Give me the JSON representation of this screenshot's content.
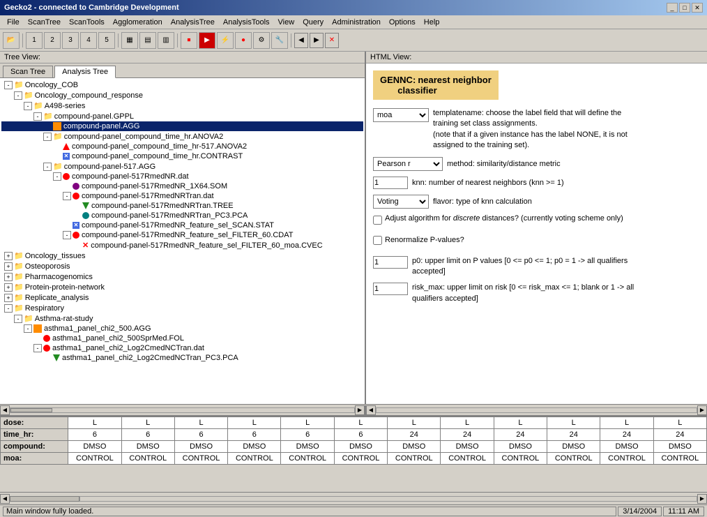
{
  "window": {
    "title": "Gecko2 - connected to Cambridge Development",
    "title_bar_buttons": [
      "_",
      "□",
      "✕"
    ]
  },
  "menu": {
    "items": [
      "File",
      "ScanTree",
      "ScanTools",
      "Agglomeration",
      "AnalysisTree",
      "AnalysisTools",
      "View",
      "Query",
      "Administration",
      "Options",
      "Help"
    ]
  },
  "toolbar": {
    "buttons": [
      "□",
      "1",
      "2",
      "3",
      "4",
      "5",
      "□",
      "□",
      "□",
      "●",
      "🔴",
      "⚡",
      "🔴",
      "⚙",
      "⚙"
    ],
    "nav": [
      "◀",
      "▶",
      "✕"
    ]
  },
  "tree_view": {
    "label": "Tree View:",
    "tabs": [
      "Scan Tree",
      "Analysis Tree"
    ],
    "active_tab": "Analysis Tree"
  },
  "tree_items": [
    {
      "id": "oncology_cob",
      "label": "Oncology_COB",
      "level": 0,
      "type": "folder",
      "expanded": true
    },
    {
      "id": "oncology_compound",
      "label": "Oncology_compound_response",
      "level": 1,
      "type": "folder",
      "expanded": true
    },
    {
      "id": "a498",
      "label": "A498-series",
      "level": 2,
      "type": "folder",
      "expanded": true
    },
    {
      "id": "compound_gppl",
      "label": "compound-panel.GPPL",
      "level": 3,
      "type": "folder",
      "expanded": true
    },
    {
      "id": "compound_agg",
      "label": "compound-panel.AGG",
      "level": 4,
      "type": "orange-sq",
      "selected": true
    },
    {
      "id": "compound_anova2",
      "label": "compound-panel_compound_time_hr.ANOVA2",
      "level": 4,
      "type": "folder"
    },
    {
      "id": "compound_anova2b",
      "label": "compound-panel_compound_time_hr-517.ANOVA2",
      "level": 5,
      "type": "tri-up-red"
    },
    {
      "id": "compound_contrast",
      "label": "compound-panel_compound_time_hr.CONTRAST",
      "level": 5,
      "type": "blue-x"
    },
    {
      "id": "compound_517agg",
      "label": "compound-panel-517.AGG",
      "level": 4,
      "type": "folder",
      "expanded": true
    },
    {
      "id": "compound_517rmed",
      "label": "compound-panel-517RmedNR.dat",
      "level": 5,
      "type": "red-circle"
    },
    {
      "id": "compound_517_1x64",
      "label": "compound-panel-517RmedNR_1X64.SOM",
      "level": 6,
      "type": "purple-circle"
    },
    {
      "id": "compound_517tran",
      "label": "compound-panel-517RmedNRTran.dat",
      "level": 6,
      "type": "red-circle"
    },
    {
      "id": "compound_517tree",
      "label": "compound-panel-517RmedNRTran.TREE",
      "level": 7,
      "type": "tri-down-green"
    },
    {
      "id": "compound_517pca",
      "label": "compound-panel-517RmedNRTran_PC3.PCA",
      "level": 7,
      "type": "teal-circle"
    },
    {
      "id": "compound_feature_scan",
      "label": "compound-panel-517RmedNR_feature_sel_SCAN.STAT",
      "level": 6,
      "type": "blue-x"
    },
    {
      "id": "compound_feature_filter",
      "label": "compound-panel-517RmedNR_feature_sel_FILTER_60.CDAT",
      "level": 6,
      "type": "red-circle"
    },
    {
      "id": "compound_cvec",
      "label": "compound-panel-517RmedNR_feature_sel_FILTER_60_moa.CVEC",
      "level": 7,
      "type": "red-x"
    },
    {
      "id": "oncology_tissues",
      "label": "Oncology_tissues",
      "level": 0,
      "type": "folder"
    },
    {
      "id": "osteoporosis",
      "label": "Osteoporosis",
      "level": 0,
      "type": "folder"
    },
    {
      "id": "pharmacogenomics",
      "label": "Pharmacogenomics",
      "level": 0,
      "type": "folder"
    },
    {
      "id": "protein_network",
      "label": "Protein-protein-network",
      "level": 0,
      "type": "folder"
    },
    {
      "id": "replicate_analysis",
      "label": "Replicate_analysis",
      "level": 0,
      "type": "folder"
    },
    {
      "id": "respiratory",
      "label": "Respiratory",
      "level": 0,
      "type": "folder",
      "expanded": true
    },
    {
      "id": "asthma_study",
      "label": "Asthma-rat-study",
      "level": 1,
      "type": "folder",
      "expanded": true
    },
    {
      "id": "asthma_chi2_500",
      "label": "asthma1_panel_chi2_500.AGG",
      "level": 2,
      "type": "orange-sq"
    },
    {
      "id": "asthma_sprmed",
      "label": "asthma1_panel_chi2_500SprMed.FOL",
      "level": 3,
      "type": "red-circle"
    },
    {
      "id": "asthma_log2",
      "label": "asthma1_panel_chi2_Log2CmedNCTran.dat",
      "level": 3,
      "type": "red-circle"
    },
    {
      "id": "asthma_pca",
      "label": "asthma1_panel_chi2_Log2CmedNCTran_PC3.PCA",
      "level": 4,
      "type": "tri-down-green"
    }
  ],
  "html_view": {
    "label": "HTML View:",
    "title_part1": "GENNC:",
    "title_part2": "nearest neighbor",
    "title_part3": "classifier",
    "form": {
      "template_field": "moa",
      "template_label": "templatename: choose the label field that will define the training set class assignments.",
      "template_note": "(note that if a given instance has the label NONE, it is not assigned to the training set).",
      "method_field": "Pearson r",
      "method_label": "method: similarity/distance metric",
      "knn_field": "1",
      "knn_label": "knn: number of nearest neighbors (knn >= 1)",
      "flavor_field": "Voting",
      "flavor_label": "flavor: type of knn calculation",
      "adjust_label": "Adjust algorithm for",
      "adjust_italic": "discrete",
      "adjust_label2": "distances? (currently voting scheme only)",
      "renorm_label": "Renormalize P-values?",
      "p0_field": "1",
      "p0_label": "p0: upper limit on P values [0 <= p0 <= 1; p0 = 1 -> all qualifiers accepted]",
      "risk_field": "1",
      "risk_label": "risk_max: upper limit on risk [0 <= risk_max <= 1; blank or 1 -> all qualifiers accepted]"
    }
  },
  "data_table": {
    "rows": [
      {
        "label": "dose:",
        "values": [
          "L",
          "L",
          "L",
          "L",
          "L",
          "L",
          "L",
          "L",
          "L",
          "L",
          "L",
          "L"
        ]
      },
      {
        "label": "time_hr:",
        "values": [
          "6",
          "6",
          "6",
          "6",
          "6",
          "6",
          "24",
          "24",
          "24",
          "24",
          "24",
          "24"
        ]
      },
      {
        "label": "compound:",
        "values": [
          "DMSO",
          "DMSO",
          "DMSO",
          "DMSO",
          "DMSO",
          "DMSO",
          "DMSO",
          "DMSO",
          "DMSO",
          "DMSO",
          "DMSO",
          "DMSO"
        ]
      },
      {
        "label": "moa:",
        "values": [
          "CONTROL",
          "CONTROL",
          "CONTROL",
          "CONTROL",
          "CONTROL",
          "CONTROL",
          "CONTROL",
          "CONTROL",
          "CONTROL",
          "CONTROL",
          "CONTROL",
          "CONTROL"
        ]
      }
    ]
  },
  "status_bar": {
    "message": "Main window fully loaded.",
    "date": "3/14/2004",
    "time": "11:11 AM"
  }
}
